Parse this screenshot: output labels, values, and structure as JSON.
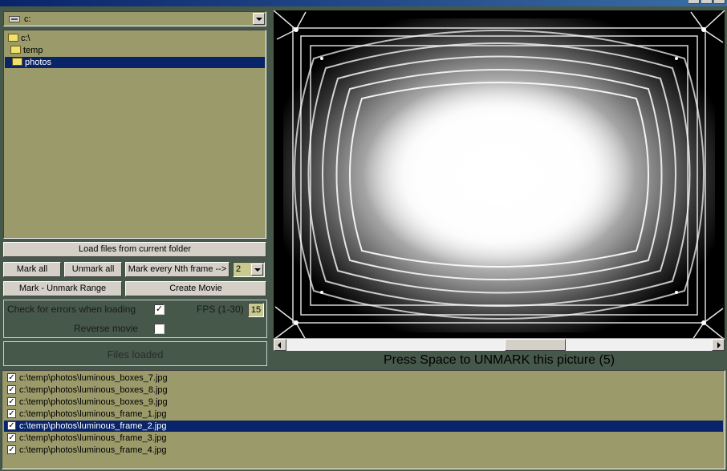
{
  "drive": {
    "value": "c:"
  },
  "folder_tree": {
    "items": [
      {
        "label": "c:\\"
      },
      {
        "label": "temp"
      },
      {
        "label": "photos",
        "selected": true
      }
    ]
  },
  "buttons": {
    "load_files": "Load files from current folder",
    "mark_all": "Mark all",
    "unmark_all": "Unmark all",
    "mark_every_nth": "Mark every Nth frame -->",
    "mark_unmark_range": "Mark - Unmark Range",
    "create_movie": "Create Movie"
  },
  "nth_select": {
    "value": "2"
  },
  "options": {
    "check_errors_label": "Check for errors when loading",
    "check_errors_checked": true,
    "check_mark": "✓",
    "fps_label": "FPS (1-30)",
    "fps_value": "15",
    "reverse_label": "Reverse movie",
    "reverse_checked": false
  },
  "status": {
    "text": "Files loaded"
  },
  "preview": {
    "prompt": "Press Space to UNMARK this picture (5)",
    "scroll_position": 0.6
  },
  "files": [
    {
      "path": "c:\\temp\\photos\\luminous_boxes_7.jpg",
      "checked": true
    },
    {
      "path": "c:\\temp\\photos\\luminous_boxes_8.jpg",
      "checked": true
    },
    {
      "path": "c:\\temp\\photos\\luminous_boxes_9.jpg",
      "checked": true
    },
    {
      "path": "c:\\temp\\photos\\luminous_frame_1.jpg",
      "checked": true
    },
    {
      "path": "c:\\temp\\photos\\luminous_frame_2.jpg",
      "checked": true,
      "selected": true
    },
    {
      "path": "c:\\temp\\photos\\luminous_frame_3.jpg",
      "checked": true
    },
    {
      "path": "c:\\temp\\photos\\luminous_frame_4.jpg",
      "checked": true
    }
  ],
  "colors": {
    "background": "#46584a",
    "panel_olive": "#9a9a6a",
    "selection": "#0a246a"
  }
}
